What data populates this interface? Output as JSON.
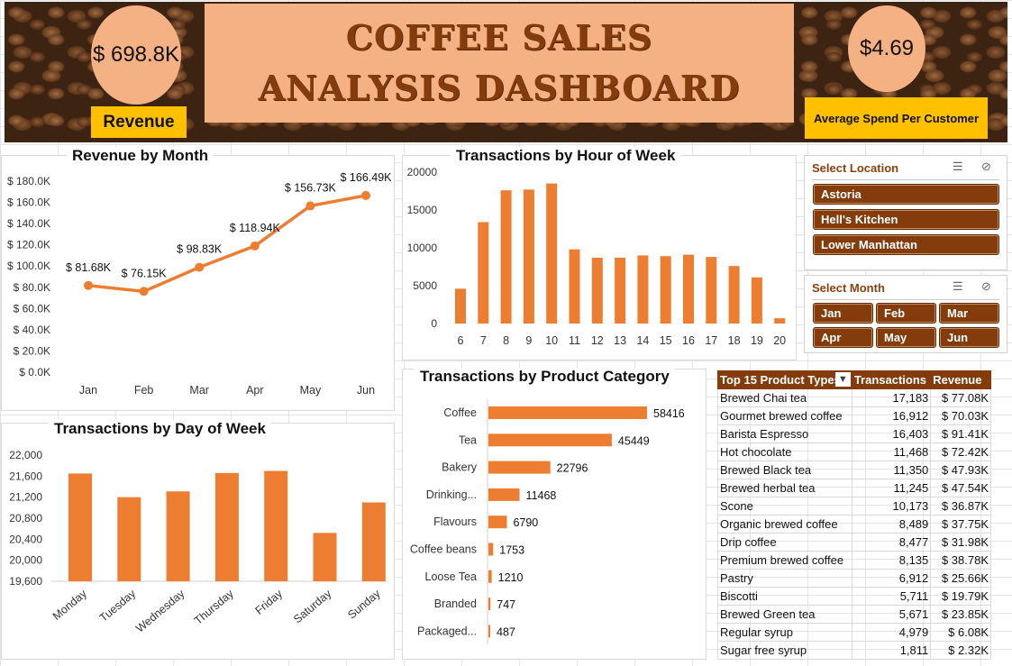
{
  "dashboard": {
    "title": "COFFEE SALES ANALYSIS DASHBOARD",
    "revenue_value": "$ 698.8K",
    "revenue_label": "Revenue",
    "avg_spend_value": "$4.69",
    "avg_spend_label": "Average Spend Per Customer"
  },
  "colors": {
    "accent": "#ed7d31",
    "brown": "#843c0c",
    "peach": "#f4b183",
    "gold": "#ffc000"
  },
  "icons": {
    "multiselect": "multi-select-icon",
    "clear_filter": "clear-filter-icon",
    "sort_filter": "filter-dropdown-icon"
  },
  "slicers": {
    "location": {
      "title": "Select Location",
      "items": [
        "Astoria",
        "Hell's Kitchen",
        "Lower Manhattan"
      ]
    },
    "month": {
      "title": "Select Month",
      "items": [
        "Jan",
        "Feb",
        "Mar",
        "Apr",
        "May",
        "Jun"
      ]
    }
  },
  "chart_data": [
    {
      "type": "line",
      "title": "Revenue by Month",
      "categories": [
        "Jan",
        "Feb",
        "Mar",
        "Apr",
        "May",
        "Jun"
      ],
      "values": [
        81.68,
        76.15,
        98.83,
        118.94,
        156.73,
        166.49
      ],
      "data_labels": [
        "$ 81.68K",
        "$ 76.15K",
        "$ 98.83K",
        "$ 118.94K",
        "$ 156.73K",
        "$ 166.49K"
      ],
      "y_ticks": [
        "$ 0.0K",
        "$ 20.0K",
        "$ 40.0K",
        "$ 60.0K",
        "$ 80.0K",
        "$ 100.0K",
        "$ 120.0K",
        "$ 140.0K",
        "$ 160.0K",
        "$ 180.0K"
      ],
      "ylim": [
        0,
        180
      ],
      "grid": false
    },
    {
      "type": "bar",
      "title": "Transactions by Hour of Week",
      "categories": [
        "6",
        "7",
        "8",
        "9",
        "10",
        "11",
        "12",
        "13",
        "14",
        "15",
        "16",
        "17",
        "18",
        "19",
        "20"
      ],
      "values": [
        4600,
        13400,
        17600,
        17700,
        18500,
        9800,
        8700,
        8700,
        9000,
        8900,
        9100,
        8800,
        7600,
        6100,
        700
      ],
      "y_ticks": [
        "0",
        "5000",
        "10000",
        "15000",
        "20000"
      ],
      "ylim": [
        0,
        20000
      ],
      "grid": false
    },
    {
      "type": "bar",
      "title": "Transactions by Day of Week",
      "categories": [
        "Monday",
        "Tuesday",
        "Wednesday",
        "Thursday",
        "Friday",
        "Saturday",
        "Sunday"
      ],
      "values": [
        21650,
        21200,
        21310,
        21660,
        21700,
        20520,
        21100
      ],
      "y_ticks": [
        "19,600",
        "20,000",
        "20,400",
        "20,800",
        "21,200",
        "21,600",
        "22,000"
      ],
      "ylim": [
        19600,
        22000
      ],
      "grid": false
    },
    {
      "type": "bar",
      "orientation": "horizontal",
      "title": "Transactions by Product Category",
      "categories": [
        "Coffee",
        "Tea",
        "Bakery",
        "Drinking...",
        "Flavours",
        "Coffee beans",
        "Loose Tea",
        "Branded",
        "Packaged..."
      ],
      "values": [
        58416,
        45449,
        22796,
        11468,
        6790,
        1753,
        1210,
        747,
        487
      ],
      "grid": false
    },
    {
      "type": "table",
      "title": "Top 15 Product Types",
      "columns": [
        "Top 15 Product Types",
        "Transactions",
        "Revenue"
      ],
      "rows": [
        [
          "Brewed Chai tea",
          "17,183",
          "$ 77.08K"
        ],
        [
          "Gourmet brewed coffee",
          "16,912",
          "$ 70.03K"
        ],
        [
          "Barista Espresso",
          "16,403",
          "$ 91.41K"
        ],
        [
          "Hot chocolate",
          "11,468",
          "$ 72.42K"
        ],
        [
          "Brewed Black tea",
          "11,350",
          "$ 47.93K"
        ],
        [
          "Brewed herbal tea",
          "11,245",
          "$ 47.54K"
        ],
        [
          "Scone",
          "10,173",
          "$ 36.87K"
        ],
        [
          "Organic brewed coffee",
          "8,489",
          "$ 37.75K"
        ],
        [
          "Drip coffee",
          "8,477",
          "$ 31.98K"
        ],
        [
          "Premium brewed coffee",
          "8,135",
          "$ 38.78K"
        ],
        [
          "Pastry",
          "6,912",
          "$ 25.66K"
        ],
        [
          "Biscotti",
          "5,711",
          "$ 19.79K"
        ],
        [
          "Brewed Green tea",
          "5,671",
          "$ 23.85K"
        ],
        [
          "Regular syrup",
          "4,979",
          "$ 6.08K"
        ],
        [
          "Sugar free syrup",
          "1,811",
          "$ 2.32K"
        ]
      ]
    }
  ]
}
